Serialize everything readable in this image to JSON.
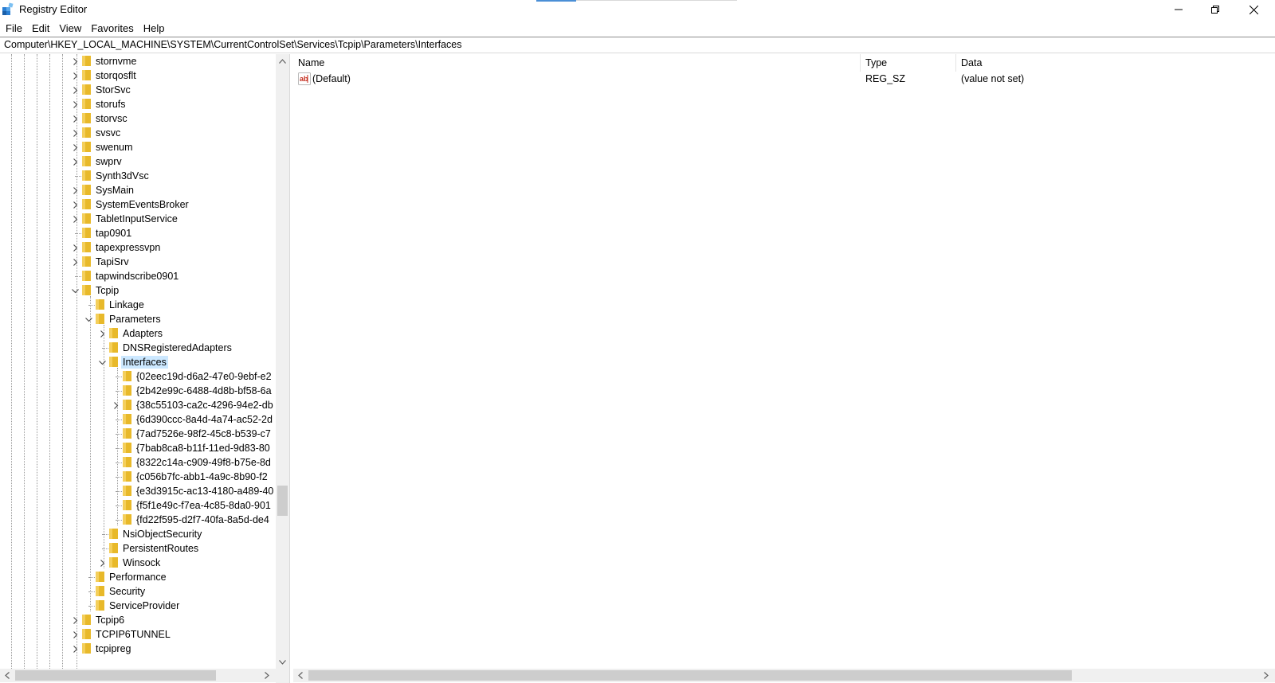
{
  "window": {
    "title": "Registry Editor",
    "controls": [
      "minimize",
      "restore",
      "close"
    ]
  },
  "menu": [
    "File",
    "Edit",
    "View",
    "Favorites",
    "Help"
  ],
  "address": "Computer\\HKEY_LOCAL_MACHINE\\SYSTEM\\CurrentControlSet\\Services\\Tcpip\\Parameters\\Interfaces",
  "tree": [
    {
      "label": "stornvme",
      "depth": 0,
      "expander": "collapsed"
    },
    {
      "label": "storqosflt",
      "depth": 0,
      "expander": "collapsed"
    },
    {
      "label": "StorSvc",
      "depth": 0,
      "expander": "collapsed"
    },
    {
      "label": "storufs",
      "depth": 0,
      "expander": "collapsed"
    },
    {
      "label": "storvsc",
      "depth": 0,
      "expander": "collapsed"
    },
    {
      "label": "svsvc",
      "depth": 0,
      "expander": "collapsed"
    },
    {
      "label": "swenum",
      "depth": 0,
      "expander": "collapsed"
    },
    {
      "label": "swprv",
      "depth": 0,
      "expander": "collapsed"
    },
    {
      "label": "Synth3dVsc",
      "depth": 0,
      "expander": "none"
    },
    {
      "label": "SysMain",
      "depth": 0,
      "expander": "collapsed"
    },
    {
      "label": "SystemEventsBroker",
      "depth": 0,
      "expander": "collapsed"
    },
    {
      "label": "TabletInputService",
      "depth": 0,
      "expander": "collapsed"
    },
    {
      "label": "tap0901",
      "depth": 0,
      "expander": "none"
    },
    {
      "label": "tapexpressvpn",
      "depth": 0,
      "expander": "collapsed"
    },
    {
      "label": "TapiSrv",
      "depth": 0,
      "expander": "collapsed"
    },
    {
      "label": "tapwindscribe0901",
      "depth": 0,
      "expander": "none"
    },
    {
      "label": "Tcpip",
      "depth": 0,
      "expander": "expanded"
    },
    {
      "label": "Linkage",
      "depth": 1,
      "expander": "none"
    },
    {
      "label": "Parameters",
      "depth": 1,
      "expander": "expanded"
    },
    {
      "label": "Adapters",
      "depth": 2,
      "expander": "collapsed"
    },
    {
      "label": "DNSRegisteredAdapters",
      "depth": 2,
      "expander": "none"
    },
    {
      "label": "Interfaces",
      "depth": 2,
      "expander": "expanded",
      "selected": true
    },
    {
      "label": "{02eec19d-d6a2-47e0-9ebf-e2",
      "depth": 3,
      "expander": "none"
    },
    {
      "label": "{2b42e99c-6488-4d8b-bf58-6a",
      "depth": 3,
      "expander": "none"
    },
    {
      "label": "{38c55103-ca2c-4296-94e2-db",
      "depth": 3,
      "expander": "collapsed"
    },
    {
      "label": "{6d390ccc-8a4d-4a74-ac52-2d",
      "depth": 3,
      "expander": "none"
    },
    {
      "label": "{7ad7526e-98f2-45c8-b539-c7",
      "depth": 3,
      "expander": "none"
    },
    {
      "label": "{7bab8ca8-b11f-11ed-9d83-80",
      "depth": 3,
      "expander": "none"
    },
    {
      "label": "{8322c14a-c909-49f8-b75e-8d",
      "depth": 3,
      "expander": "none"
    },
    {
      "label": "{c056b7fc-abb1-4a9c-8b90-f2",
      "depth": 3,
      "expander": "none"
    },
    {
      "label": "{e3d3915c-ac13-4180-a489-40",
      "depth": 3,
      "expander": "none"
    },
    {
      "label": "{f5f1e49c-f7ea-4c85-8da0-901",
      "depth": 3,
      "expander": "none"
    },
    {
      "label": "{fd22f595-d2f7-40fa-8a5d-de4",
      "depth": 3,
      "expander": "none"
    },
    {
      "label": "NsiObjectSecurity",
      "depth": 2,
      "expander": "none"
    },
    {
      "label": "PersistentRoutes",
      "depth": 2,
      "expander": "none"
    },
    {
      "label": "Winsock",
      "depth": 2,
      "expander": "collapsed"
    },
    {
      "label": "Performance",
      "depth": 1,
      "expander": "none"
    },
    {
      "label": "Security",
      "depth": 1,
      "expander": "none"
    },
    {
      "label": "ServiceProvider",
      "depth": 1,
      "expander": "none"
    },
    {
      "label": "Tcpip6",
      "depth": 0,
      "expander": "collapsed"
    },
    {
      "label": "TCPIP6TUNNEL",
      "depth": 0,
      "expander": "collapsed"
    },
    {
      "label": "tcpipreg",
      "depth": 0,
      "expander": "collapsed"
    }
  ],
  "columns": {
    "name": "Name",
    "type": "Type",
    "data": "Data"
  },
  "values": [
    {
      "name": "(Default)",
      "type": "REG_SZ",
      "data": "(value not set)",
      "icon": "string-value-icon"
    }
  ],
  "colors": {
    "selection": "#cce8ff",
    "folder": "#e8b92a",
    "accent": "#4a8fd6"
  }
}
